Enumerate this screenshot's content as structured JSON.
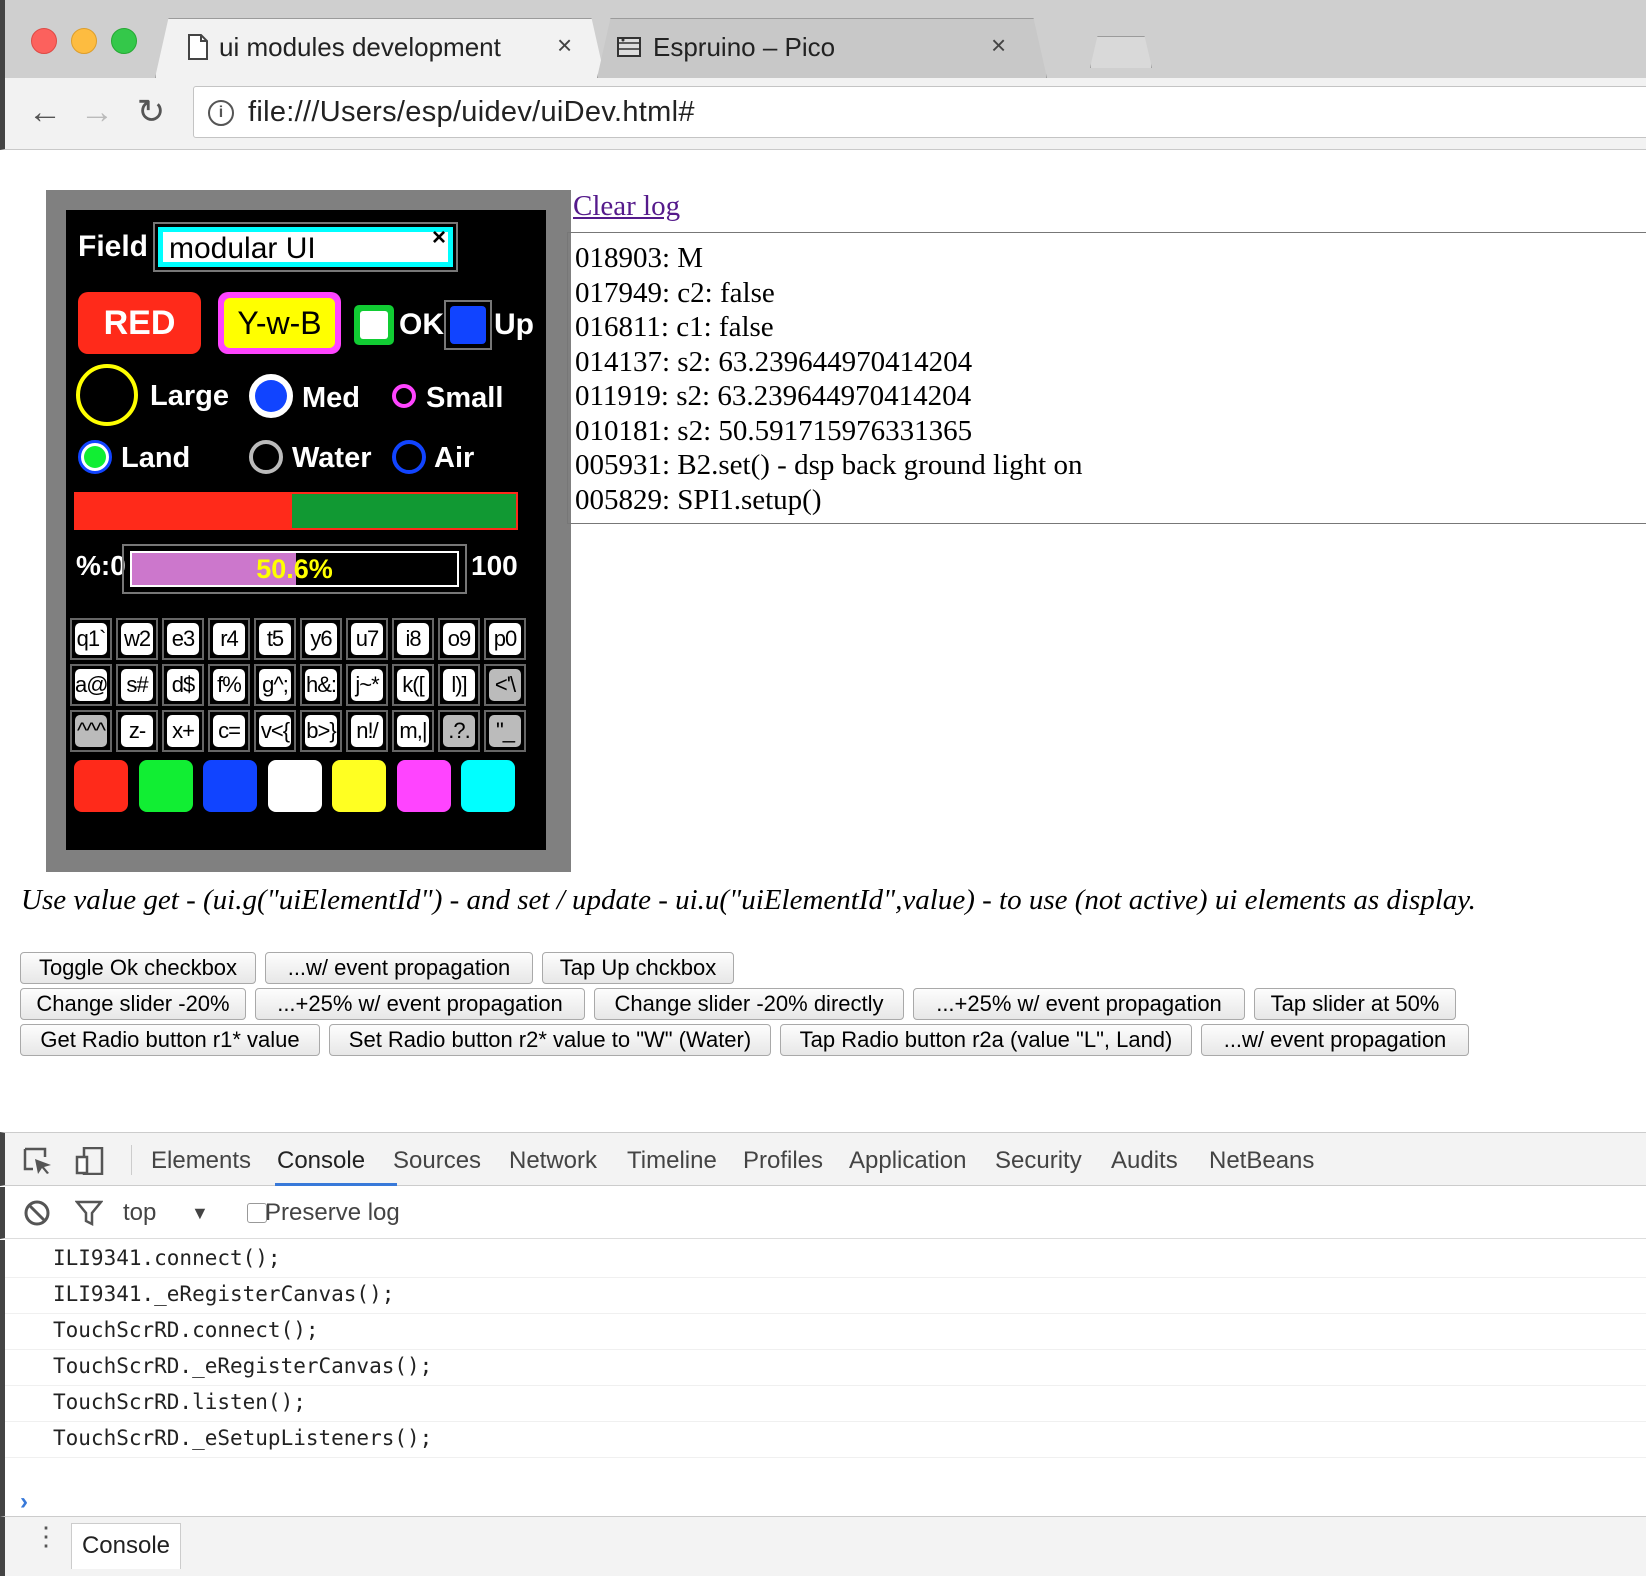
{
  "browser": {
    "tabs": [
      {
        "title": "ui modules development",
        "close": "×",
        "icon": "document-icon",
        "active": true
      },
      {
        "title": "Espruino – Pico",
        "close": "×",
        "icon": "espruino-icon",
        "active": false
      }
    ],
    "url": "file:///Users/esp/uidev/uiDev.html#",
    "back_icon": "←",
    "forward_icon": "→",
    "reload_icon": "↻",
    "info_icon": "i"
  },
  "device": {
    "field_label": "Field",
    "field_value": "modular UI",
    "field_clear": "×",
    "btn_red": "RED",
    "btn_ywb": "Y-w-B",
    "chk_ok_label": "OK",
    "chk_up_label": "Up",
    "radios_size": [
      {
        "label": "Large"
      },
      {
        "label": "Med"
      },
      {
        "label": "Small"
      }
    ],
    "radios_place": [
      {
        "label": "Land"
      },
      {
        "label": "Water"
      },
      {
        "label": "Air"
      }
    ],
    "slider_value_fraction": 0.49,
    "pct_min_label": "%:0",
    "pct_max_label": "100",
    "pct_value_text": "50.6%",
    "pct_value": 50.6,
    "keyboard": {
      "row1": [
        "q1`",
        "w2",
        "e3",
        "r4",
        "t5",
        "y6",
        "u7",
        "i8",
        "o9",
        "p0"
      ],
      "row2": [
        "a@",
        "s#",
        "d$",
        "f%",
        "g^;",
        "h&:",
        "j~*",
        "k([",
        "l)]",
        "<'\\"
      ],
      "row3": [
        "^^^",
        "z-",
        "x+",
        "c=",
        "v<{",
        "b>}",
        "n!/",
        "m,|",
        ".?.",
        "\"_"
      ]
    },
    "colors": [
      "#ff2a1a",
      "#11ee33",
      "#1144ff",
      "#ffffff",
      "#ffff22",
      "#ff44ff",
      "#00ffff"
    ]
  },
  "log": {
    "clear_label": "Clear log",
    "lines": [
      "018903: M",
      "017949: c2: false",
      "016811: c1: false",
      "014137: s2: 63.239644970414204",
      "011919: s2: 63.239644970414204",
      "010181: s2: 50.591715976331365",
      "005931: B2.set() - dsp back ground light on",
      "005829: SPI1.setup()"
    ]
  },
  "usage_text": "Use value get - (ui.g(\"uiElementId\") - and set / update - ui.u(\"uiElementId\",value) - to use (not active) ui elements as display.",
  "buttons": {
    "row1": [
      "Toggle Ok checkbox",
      "...w/ event propagation",
      "Tap Up chckbox"
    ],
    "row2": [
      "Change slider -20%",
      "...+25% w/ event propagation",
      "Change slider -20% directly",
      "...+25% w/ event propagation",
      "Tap slider at 50%"
    ],
    "row3": [
      "Get Radio button r1* value",
      "Set Radio button r2* value to \"W\" (Water)",
      "Tap Radio button r2a (value \"L\", Land)",
      "...w/ event propagation"
    ]
  },
  "devtools": {
    "tabs": [
      "Elements",
      "Console",
      "Sources",
      "Network",
      "Timeline",
      "Profiles",
      "Application",
      "Security",
      "Audits",
      "NetBeans"
    ],
    "active_tab": "Console",
    "context": "top",
    "context_arrow": "▼",
    "preserve_log": "Preserve log",
    "console_lines": [
      "ILI9341.connect();",
      "ILI9341._eRegisterCanvas();",
      "TouchScrRD.connect();",
      "TouchScrRD._eRegisterCanvas();",
      "TouchScrRD.listen();",
      "TouchScrRD._eSetupListeners();"
    ],
    "prompt": "›",
    "drawer_menu": "⋮",
    "drawer_tab": "Console"
  }
}
